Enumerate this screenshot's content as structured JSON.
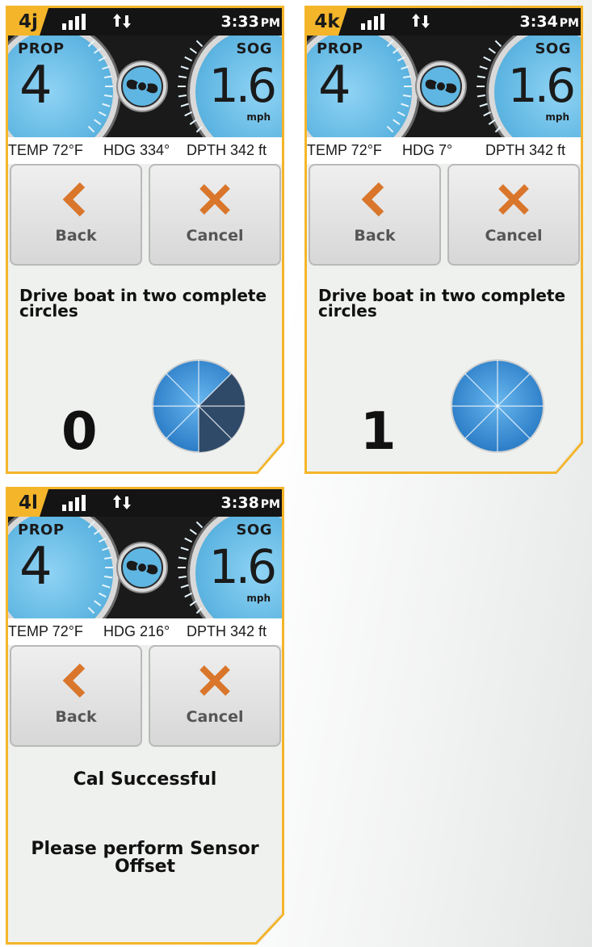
{
  "panels": [
    {
      "label": "4j",
      "time": "3:33",
      "ampm": "PM",
      "prop_label": "PROP",
      "prop_value": "4",
      "sog_label": "SOG",
      "sog_value": "1.6",
      "sog_unit": "mph",
      "temp": "TEMP 72°F",
      "heading": "HDG 334°",
      "depth": "DPTH  342 ft",
      "back_label": "Back",
      "cancel_label": "Cancel",
      "message": "Drive boat in two complete circles",
      "count": "0",
      "circle_progress": 0.375
    },
    {
      "label": "4k",
      "time": "3:34",
      "ampm": "PM",
      "prop_label": "PROP",
      "prop_value": "4",
      "sog_label": "SOG",
      "sog_value": "1.6",
      "sog_unit": "mph",
      "temp": "TEMP 72°F",
      "heading": "HDG 7°",
      "depth": "DPTH  342 ft",
      "back_label": "Back",
      "cancel_label": "Cancel",
      "message": "Drive boat in two complete circles",
      "count": "1",
      "circle_progress": 0
    },
    {
      "label": "4l",
      "time": "3:38",
      "ampm": "PM",
      "prop_label": "PROP",
      "prop_value": "4",
      "sog_label": "SOG",
      "sog_value": "1.6",
      "sog_unit": "mph",
      "temp": "TEMP 72°F",
      "heading": "HDG 216°",
      "depth": "DPTH  342 ft",
      "back_label": "Back",
      "cancel_label": "Cancel",
      "message_1": "Cal Successful",
      "message_2": "Please perform Sensor Offset"
    }
  ],
  "colors": {
    "accent": "#f4b52a",
    "gauge_blue": "#5fb6e2",
    "icon_orange": "#d9762b",
    "progress_dark": "#2f4a68",
    "circle_blue": "#3a8fd6"
  },
  "icons": {
    "signal": "signal-bars-icon",
    "data": "data-arrows-icon",
    "propeller": "propeller-icon",
    "back": "chevron-left-icon",
    "cancel": "x-close-icon"
  }
}
